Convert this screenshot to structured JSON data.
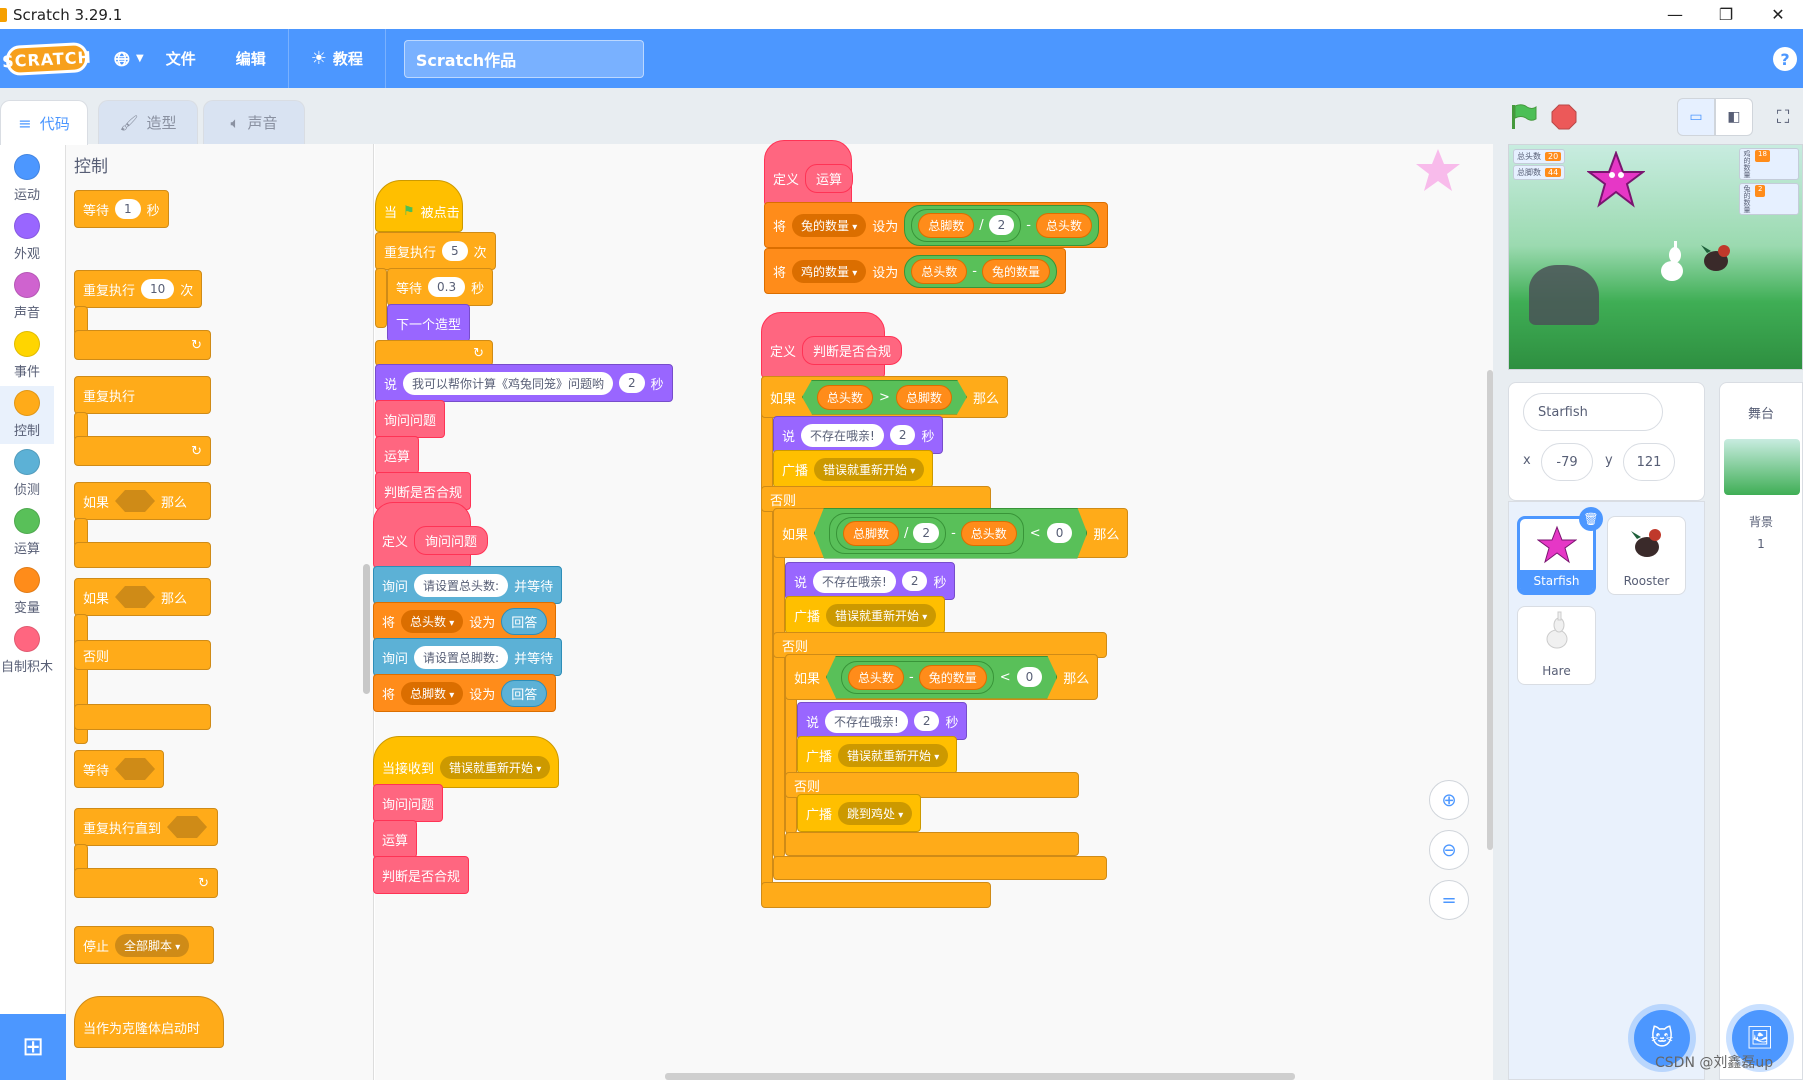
{
  "window": {
    "title": "Scratch 3.29.1",
    "minimize": "—",
    "maximize": "❐",
    "close": "✕"
  },
  "menubar": {
    "logo": "SCRATCH",
    "language_icon": "globe-icon",
    "file": "文件",
    "edit": "编辑",
    "tutorials": "教程",
    "project_title": "Scratch作品",
    "help": "?"
  },
  "tabs": {
    "code": "代码",
    "costumes": "造型",
    "sounds": "声音"
  },
  "categories": [
    "运动",
    "外观",
    "声音",
    "事件",
    "控制",
    "侦测",
    "运算",
    "变量",
    "自制积木"
  ],
  "category_colors": [
    "#4c97ff",
    "#9966ff",
    "#cf63cf",
    "#ffd500",
    "#ffab19",
    "#5cb1d6",
    "#59c059",
    "#ff8c1a",
    "#ff6680"
  ],
  "palette": {
    "heading": "控制",
    "wait": {
      "l": "等待",
      "v": "1",
      "u": "秒"
    },
    "repeat": {
      "l": "重复执行",
      "v": "10",
      "u": "次"
    },
    "forever": "重复执行",
    "if_then": {
      "a": "如果",
      "b": "那么"
    },
    "if_else": {
      "a": "如果",
      "b": "那么",
      "c": "否则"
    },
    "wait_until": "等待",
    "repeat_until": "重复执行直到",
    "stop": {
      "l": "停止",
      "v": "全部脚本"
    },
    "clone_start": "当作为克隆体启动时"
  },
  "s1": {
    "when": "当",
    "clicked": "被点击",
    "repeat": {
      "l": "重复执行",
      "v": "5",
      "u": "次"
    },
    "wait": {
      "l": "等待",
      "v": "0.3",
      "u": "秒"
    },
    "next_costume": "下一个造型",
    "say": {
      "l": "说",
      "v": "我可以帮你计算《鸡兔同笼》问题哟",
      "n": "2",
      "u": "秒"
    },
    "c1": "询问问题",
    "c2": "运算",
    "c3": "判断是否合规"
  },
  "s2": {
    "define": "定义",
    "name": "询问问题",
    "ask1": {
      "l": "询问",
      "v": "请设置总头数:",
      "w": "并等待"
    },
    "set1": {
      "l": "将",
      "var": "总头数",
      "to": "设为",
      "v": "回答"
    },
    "ask2": {
      "l": "询问",
      "v": "请设置总脚数:",
      "w": "并等待"
    },
    "set2": {
      "l": "将",
      "var": "总脚数",
      "to": "设为",
      "v": "回答"
    }
  },
  "s3": {
    "recv": "当接收到",
    "msg": "错误就重新开始",
    "c1": "询问问题",
    "c2": "运算",
    "c3": "判断是否合规"
  },
  "s4": {
    "define": "定义",
    "name": "运算",
    "set1": {
      "l": "将",
      "var": "兔的数量",
      "to": "设为",
      "a": "总脚数",
      "op1": "/",
      "n": "2",
      "op2": "-",
      "b": "总头数"
    },
    "set2": {
      "l": "将",
      "var": "鸡的数量",
      "to": "设为",
      "a": "总头数",
      "op": "-",
      "b": "兔的数量"
    }
  },
  "s5": {
    "define": "定义",
    "name": "判断是否合规",
    "if1": {
      "l": "如果",
      "a": "总头数",
      "op": ">",
      "b": "总脚数",
      "then": "那么"
    },
    "say1": {
      "l": "说",
      "v": "不存在哦亲!",
      "n": "2",
      "u": "秒"
    },
    "bc1": {
      "l": "广播",
      "v": "错误就重新开始"
    },
    "else1": "否则",
    "if2": {
      "l": "如果",
      "a": "总脚数",
      "d": "/",
      "n": "2",
      "m": "-",
      "b": "总头数",
      "lt": "<",
      "z": "0",
      "then": "那么"
    },
    "say2": {
      "l": "说",
      "v": "不存在哦亲!",
      "n": "2",
      "u": "秒"
    },
    "bc2": {
      "l": "广播",
      "v": "错误就重新开始"
    },
    "else2": "否则",
    "if3": {
      "l": "如果",
      "a": "总头数",
      "m": "-",
      "b": "兔的数量",
      "lt": "<",
      "z": "0",
      "then": "那么"
    },
    "say3": {
      "l": "说",
      "v": "不存在哦亲!",
      "n": "2",
      "u": "秒"
    },
    "bc3": {
      "l": "广播",
      "v": "错误就重新开始"
    },
    "else3": "否则",
    "bc4": {
      "l": "广播",
      "v": "跳到鸡处"
    }
  },
  "stage": {
    "monitors": [
      {
        "label": "总头数",
        "value": "20"
      },
      {
        "label": "总脚数",
        "value": "44"
      }
    ],
    "right_monitors": [
      {
        "label": "鸡的数量",
        "value": "18"
      },
      {
        "label": "兔的数量",
        "value": "2"
      }
    ]
  },
  "sprite_info": {
    "name": "Starfish",
    "x_label": "x",
    "x": "-79",
    "y_label": "y",
    "y": "121"
  },
  "sprites": [
    "Starfish",
    "Rooster",
    "Hare"
  ],
  "stage_col": {
    "title": "舞台",
    "backdrop_label": "背景",
    "backdrop_count": "1"
  },
  "watermark": "CSDN @刘鑫磊up"
}
